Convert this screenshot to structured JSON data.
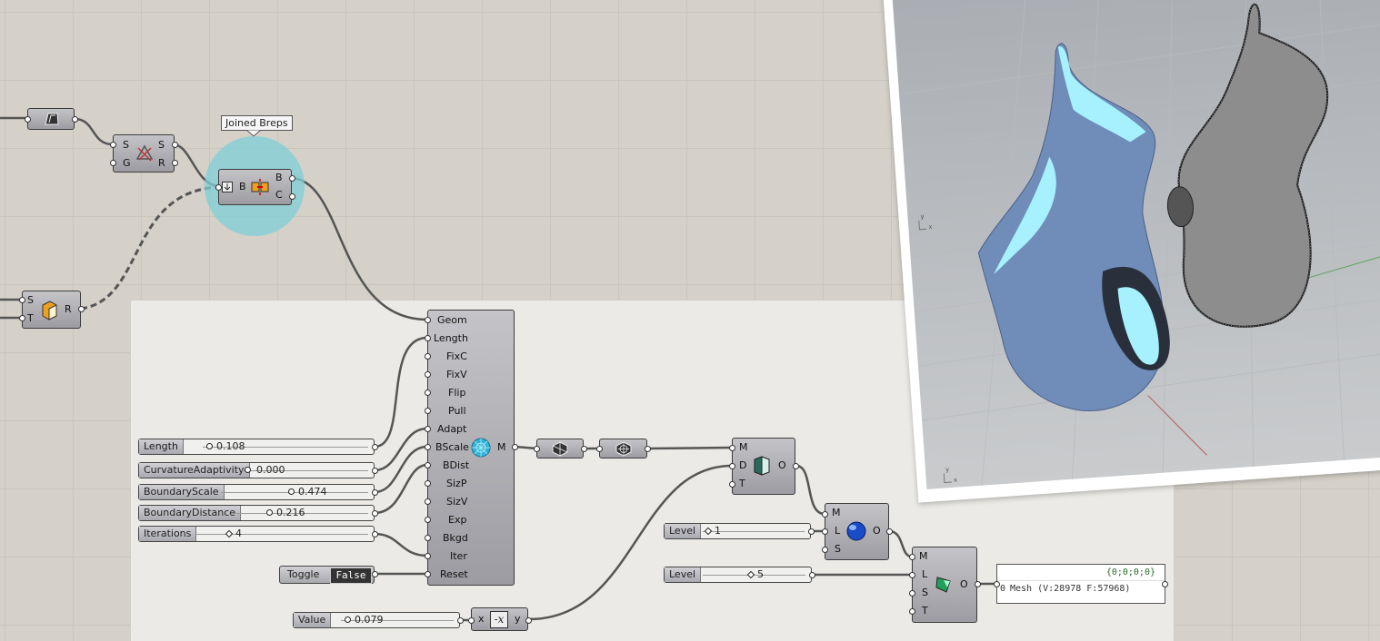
{
  "tooltip": {
    "text": "Joined Breps"
  },
  "join_component": {
    "input": "B",
    "outputs": [
      "B",
      "C"
    ]
  },
  "sweep_component": {
    "inputs": [
      "S",
      "G"
    ],
    "outputs": [
      "S",
      "R"
    ]
  },
  "extrude_component": {
    "inputs": [
      "S",
      "T"
    ],
    "output": "R"
  },
  "mesh_component": {
    "inputs": [
      "Geom",
      "Length",
      "FixC",
      "FixV",
      "Flip",
      "Pull",
      "Adapt",
      "BScale",
      "BDist",
      "SizP",
      "SizV",
      "Exp",
      "Bkgd",
      "Iter",
      "Reset"
    ],
    "output": "M"
  },
  "sliders": {
    "length": {
      "label": "Length",
      "value": "0.108",
      "fraction": 0.108
    },
    "curvature": {
      "label": "CurvatureAdaptivity",
      "value": "0.000",
      "fraction": 0.0
    },
    "boundary_scale": {
      "label": "BoundaryScale",
      "value": "0.474",
      "fraction": 0.474
    },
    "boundary_distance": {
      "label": "BoundaryDistance",
      "value": "0.216",
      "fraction": 0.216
    },
    "iterations": {
      "label": "Iterations",
      "value": "4"
    },
    "value": {
      "label": "Value",
      "value": "0.079"
    },
    "level1": {
      "label": "Level",
      "value": "1"
    },
    "level2": {
      "label": "Level",
      "value": "5"
    }
  },
  "toggle": {
    "label": "Toggle",
    "state": "False"
  },
  "negate_component": {
    "input": "x",
    "output": "y"
  },
  "deform_component": {
    "inputs": [
      "M",
      "D",
      "T"
    ],
    "output": "O"
  },
  "subdiv_component": {
    "inputs": [
      "M",
      "L",
      "S"
    ],
    "output": "O"
  },
  "smooth_component": {
    "inputs": [
      "M",
      "L",
      "S",
      "T"
    ],
    "output": "O"
  },
  "panel": {
    "path": "{0;0;0;0}",
    "index": "0",
    "content": "Mesh (V:28978  F:57968)"
  },
  "viewport": {
    "axis_x": "x",
    "axis_y": "y"
  },
  "colors": {
    "canvas": "#d5d1c9",
    "group": "#ebeae6",
    "blob": "#6f8db8",
    "highlight": "#a7f1ff",
    "join_circle": "#8fd0d8"
  }
}
